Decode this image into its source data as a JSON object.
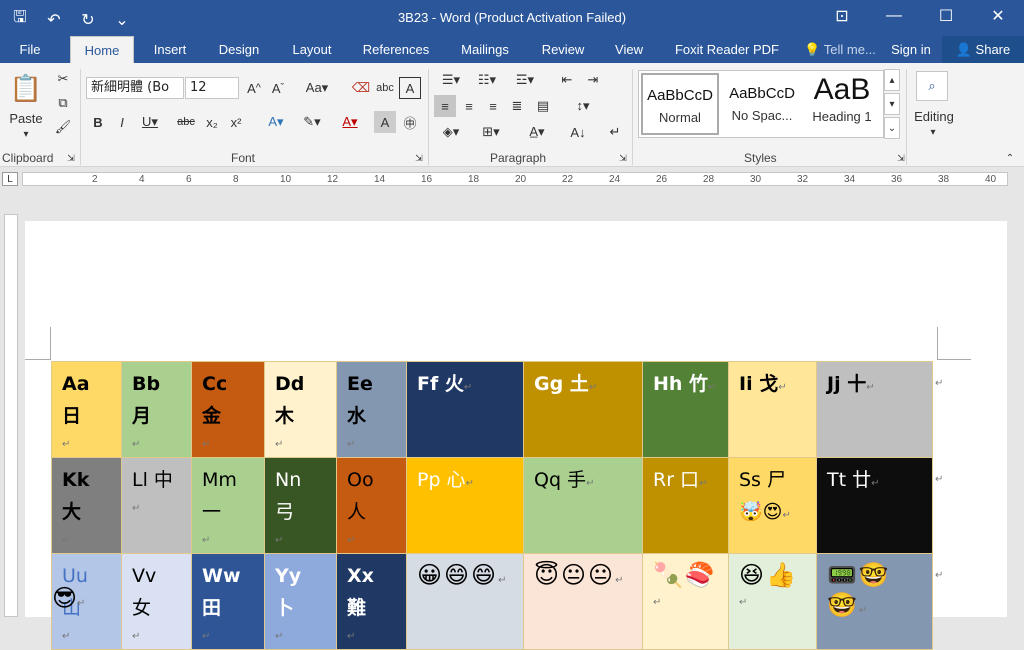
{
  "window": {
    "title": "3B23 - Word (Product Activation Failed)"
  },
  "qat_icons": [
    "save-icon",
    "undo-icon",
    "redo-icon",
    "customize-icon"
  ],
  "winctl_icons": [
    "ribbon-display-icon",
    "minimize-icon",
    "maximize-icon",
    "close-icon"
  ],
  "tabs": {
    "file": "File",
    "home": "Home",
    "insert": "Insert",
    "design": "Design",
    "layout": "Layout",
    "references": "References",
    "mailings": "Mailings",
    "review": "Review",
    "view": "View",
    "foxit": "Foxit Reader PDF",
    "tellme": "Tell me...",
    "signin": "Sign in",
    "share": "Share"
  },
  "ribbon": {
    "paste": "Paste",
    "font_name": "新細明體 (Bo",
    "font_size": "12",
    "editing": "Editing",
    "groups": {
      "clipboard": "Clipboard",
      "font": "Font",
      "paragraph": "Paragraph",
      "styles": "Styles"
    },
    "styles": [
      {
        "preview": "AaBbCcD",
        "name": "Normal"
      },
      {
        "preview": "AaBbCcD",
        "name": "No Spac..."
      },
      {
        "preview": "AaB",
        "name": "Heading 1"
      }
    ]
  },
  "ruler_numbers": [
    "2",
    "4",
    "6",
    "8",
    "10",
    "12",
    "14",
    "16",
    "18",
    "20",
    "22",
    "24",
    "26",
    "28",
    "30",
    "32",
    "34",
    "36",
    "38",
    "40"
  ],
  "table": [
    [
      {
        "text": "Aa 日",
        "bg": "#ffd966",
        "color": "#000",
        "bold": true
      },
      {
        "text": "Bb 月",
        "bg": "#a9d08e",
        "color": "#000",
        "bold": true
      },
      {
        "text": "Cc 金",
        "bg": "#c55a11",
        "color": "#000",
        "bold": true
      },
      {
        "text": "Dd 木",
        "bg": "#fff2cc",
        "color": "#000",
        "bold": true
      },
      {
        "text": "Ee 水",
        "bg": "#8497b0",
        "color": "#000",
        "bold": true
      },
      {
        "text": "Ff 火",
        "bg": "#203864",
        "color": "#fff",
        "bold": true
      },
      {
        "text": "Gg 土",
        "bg": "#bf9000",
        "color": "#fff",
        "bold": true
      },
      {
        "text": "Hh 竹",
        "bg": "#538135",
        "color": "#fff",
        "bold": true
      },
      {
        "text": "Ii 戈",
        "bg": "#ffe699",
        "color": "#000",
        "bold": true
      },
      {
        "text": "Jj 十",
        "bg": "#bfbfbf",
        "color": "#000",
        "bold": true
      }
    ],
    [
      {
        "text": "Kk 大",
        "bg": "#7f7f7f",
        "color": "#000",
        "bold": true
      },
      {
        "text": "Ll 中",
        "bg": "#bfbfbf",
        "color": "#000",
        "bold": false
      },
      {
        "text": "Mm 一",
        "bg": "#a9d08e",
        "color": "#000",
        "bold": false
      },
      {
        "text": "Nn 弓",
        "bg": "#375623",
        "color": "#fff",
        "bold": false
      },
      {
        "text": "Oo 人",
        "bg": "#c55a11",
        "color": "#000",
        "bold": false
      },
      {
        "text": "Pp 心",
        "bg": "#ffc000",
        "color": "#fff",
        "bold": false
      },
      {
        "text": "Qq 手",
        "bg": "#a9d08e",
        "color": "#000",
        "bold": false
      },
      {
        "text": "Rr 口",
        "bg": "#bf9000",
        "color": "#fff",
        "bold": false
      },
      {
        "text": "Ss 尸 🤯😍",
        "bg": "#ffd966",
        "color": "#000",
        "bold": false
      },
      {
        "text": "Tt 廿",
        "bg": "#0d0d0d",
        "color": "#fff",
        "bold": false
      }
    ],
    [
      {
        "text": "Uu 山",
        "bg": "#b4c6e7",
        "color": "#4472c4",
        "bold": false
      },
      {
        "text": "Vv 女",
        "bg": "#d9e1f2",
        "color": "#000",
        "bold": false
      },
      {
        "text": "Ww 田",
        "bg": "#2f5597",
        "color": "#fff",
        "bold": true
      },
      {
        "text": "Yy 卜",
        "bg": "#8ea9db",
        "color": "#fff",
        "bold": true
      },
      {
        "text": "Xx 難",
        "bg": "#1f3864",
        "color": "#fff",
        "bold": true
      },
      {
        "text": "😀😄😄",
        "bg": "#d6dce4",
        "color": "#000",
        "bold": false
      },
      {
        "text": "😇😐😐",
        "bg": "#fbe5d6",
        "color": "#000",
        "bold": false
      },
      {
        "text": "🍡🍣",
        "bg": "#fff2cc",
        "color": "#000",
        "bold": false
      },
      {
        "text": "😆👍",
        "bg": "#e2efda",
        "color": "#000",
        "bold": false
      },
      {
        "text": "📟🤓🤓",
        "bg": "#8497b0",
        "color": "#000",
        "bold": false
      }
    ]
  ],
  "after_table": "😎"
}
